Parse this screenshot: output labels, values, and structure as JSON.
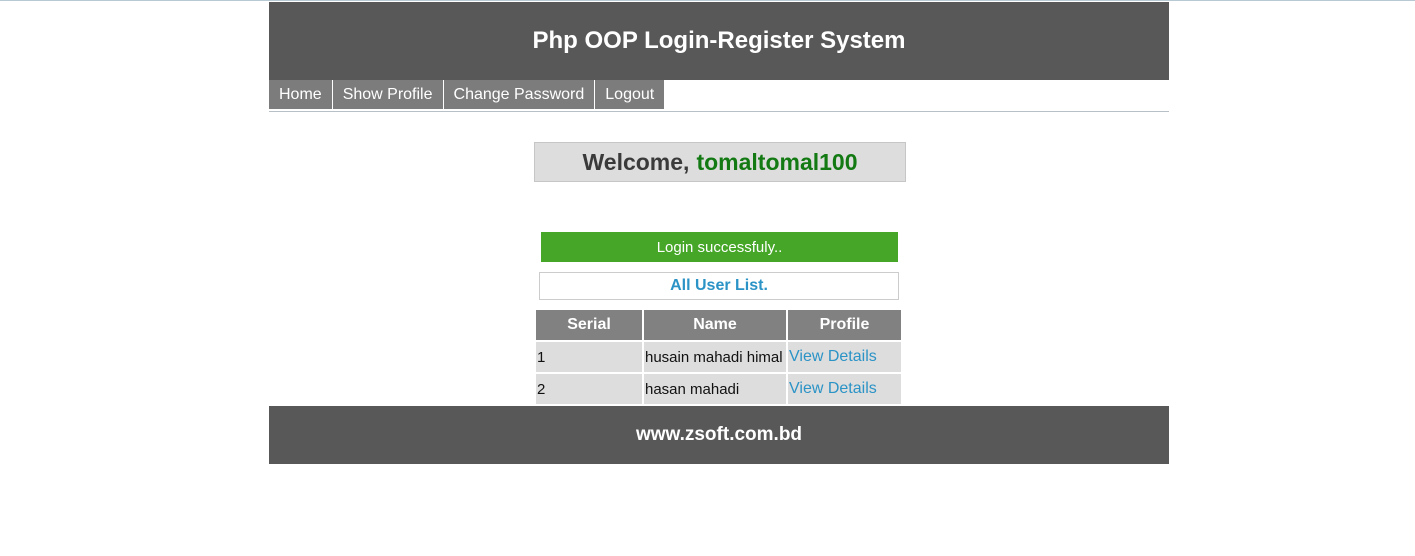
{
  "header": {
    "title": "Php OOP Login-Register System"
  },
  "nav": {
    "items": [
      {
        "label": "Home"
      },
      {
        "label": "Show Profile"
      },
      {
        "label": "Change Password"
      },
      {
        "label": "Logout"
      }
    ]
  },
  "welcome": {
    "prefix": "Welcome,",
    "username": "tomaltomal100"
  },
  "alert": {
    "message": "Login successfuly.."
  },
  "user_list": {
    "title": "All User List.",
    "columns": [
      "Serial",
      "Name",
      "Profile"
    ],
    "rows": [
      {
        "serial": "1",
        "name": "husain mahadi himal",
        "profile": "View Details"
      },
      {
        "serial": "2",
        "name": "hasan mahadi",
        "profile": "View Details"
      }
    ]
  },
  "footer": {
    "text": "www.zsoft.com.bd"
  },
  "colors": {
    "header_bg": "#585858",
    "nav_bg": "#7c7c7c",
    "success": "#45a627",
    "link": "#2b93c6",
    "username": "#137a13"
  }
}
